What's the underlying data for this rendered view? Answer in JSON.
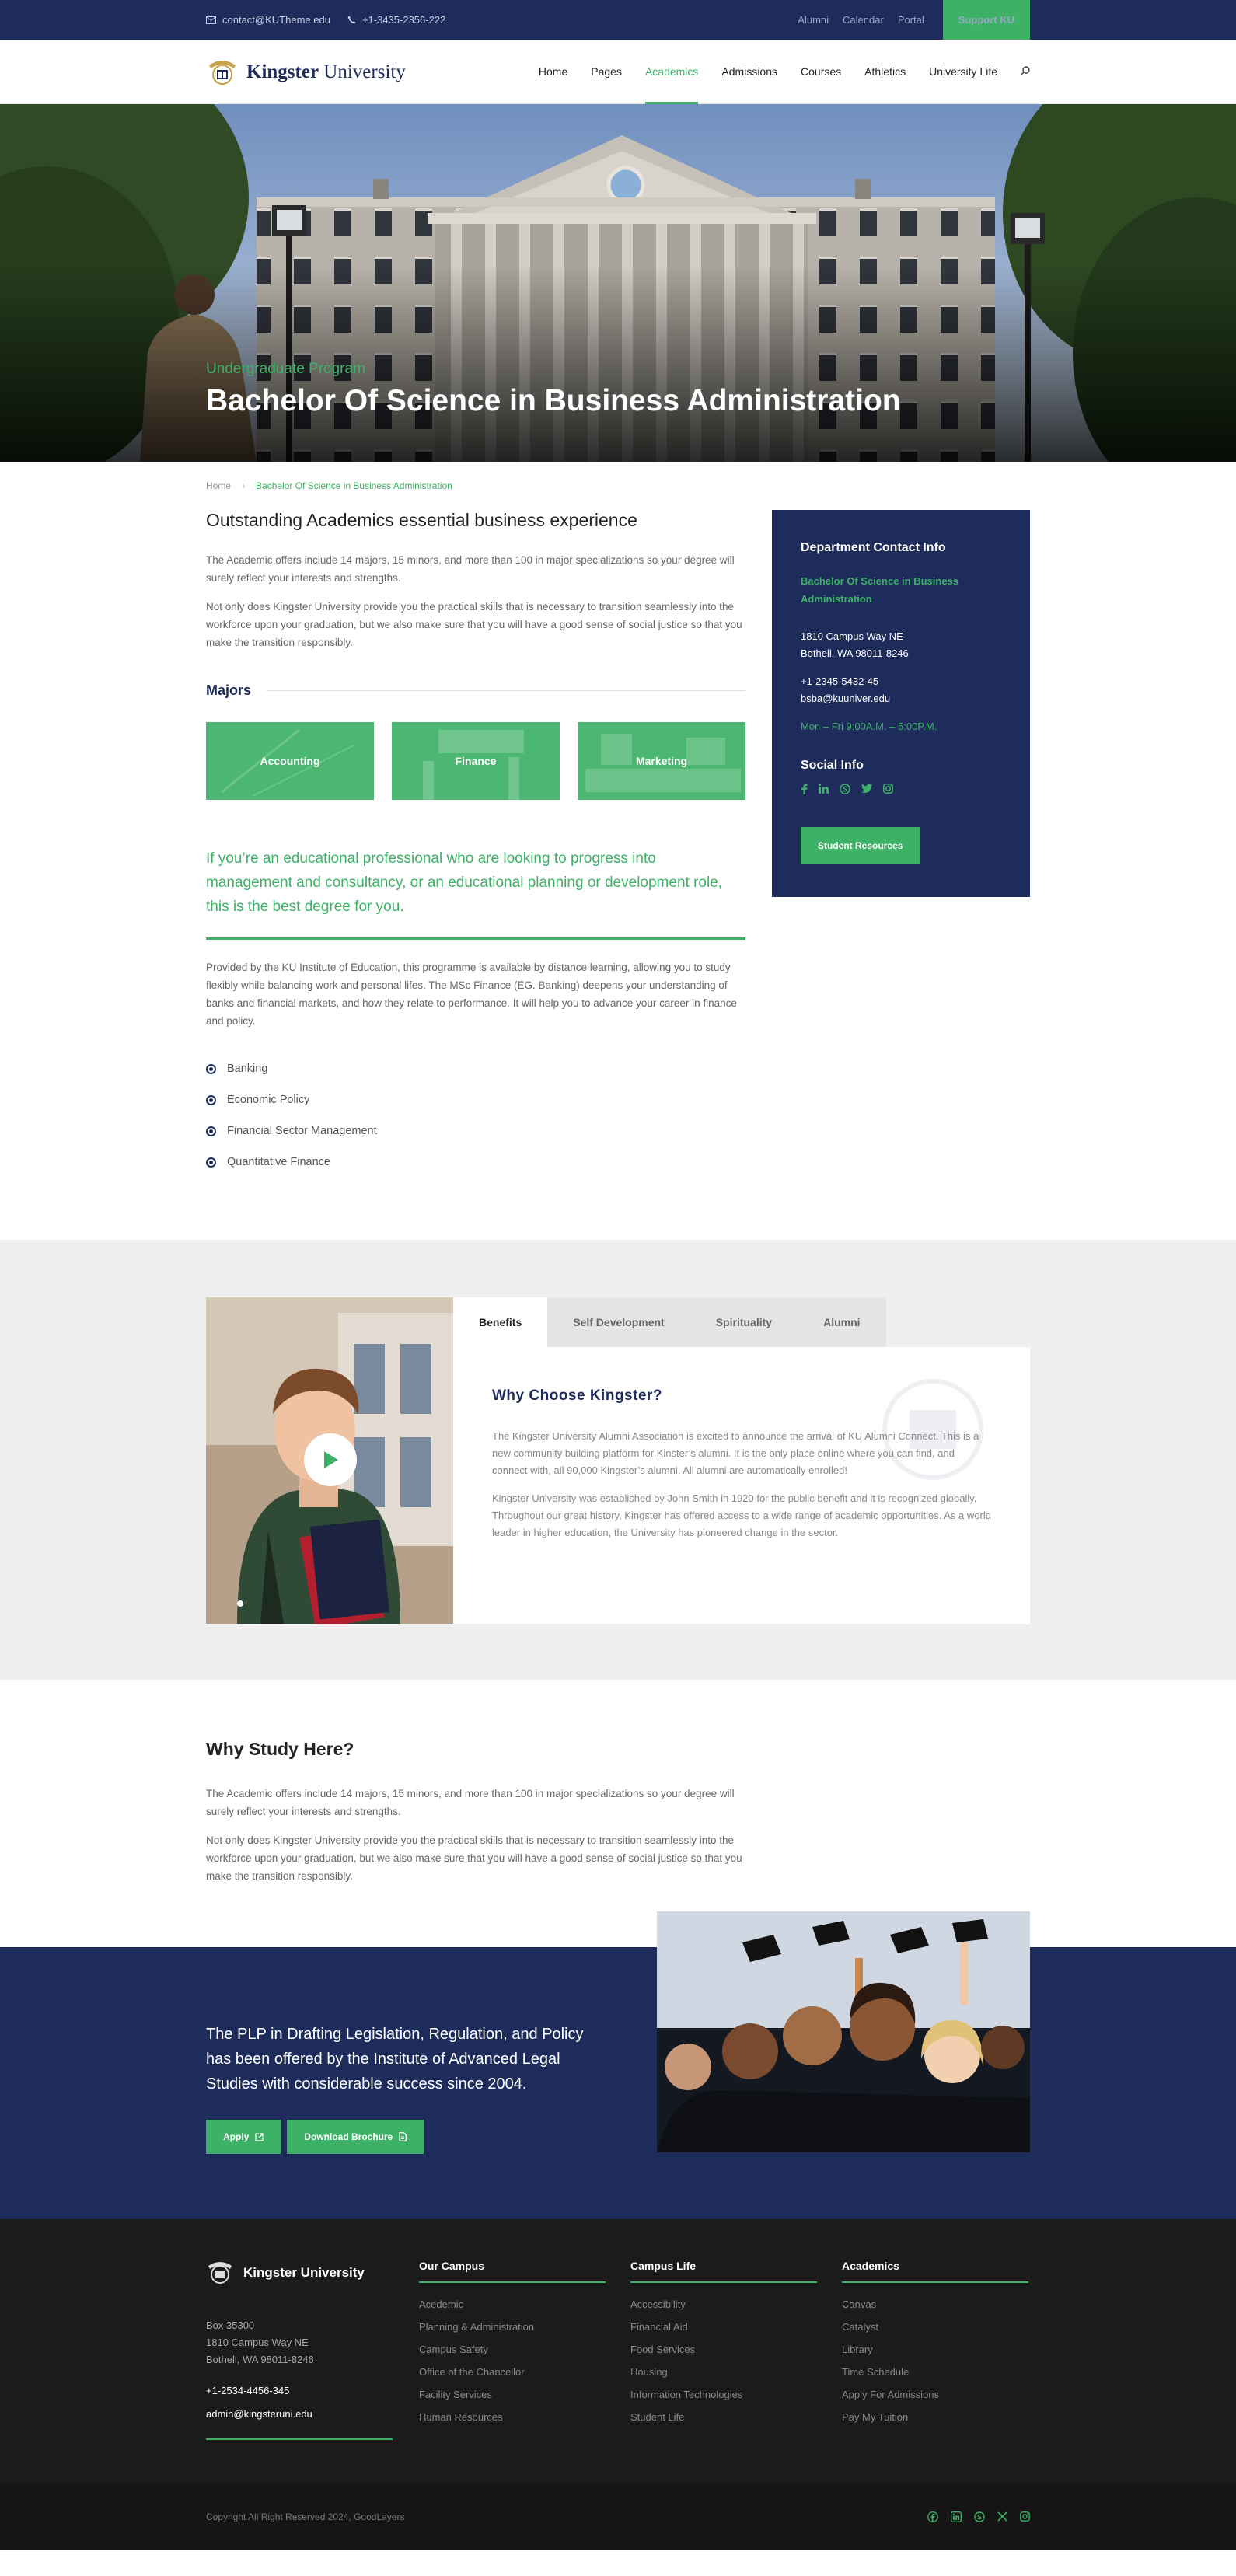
{
  "topbar": {
    "email": "contact@KUTheme.edu",
    "phone": "+1-3435-2356-222",
    "links": [
      "Alumni",
      "Calendar",
      "Portal"
    ],
    "support": "Support KU"
  },
  "header": {
    "logo_bold": "Kingster",
    "logo_rest": " University",
    "nav": [
      "Home",
      "Pages",
      "Academics",
      "Admissions",
      "Courses",
      "Athletics",
      "University Life"
    ],
    "active_nav": "Academics"
  },
  "hero": {
    "subtitle": "Undergraduate Program",
    "title": "Bachelor Of Science in Business Administration"
  },
  "breadcrumb": {
    "home": "Home",
    "sep": "›",
    "current": "Bachelor Of Science in Business Administration"
  },
  "main": {
    "heading": "Outstanding Academics essential business experience",
    "p1": "The Academic offers include 14 majors, 15 minors, and more than 100 in major specializations so your degree will surely reflect your interests and strengths.",
    "p2": "Not only does Kingster University provide you the practical skills that is necessary to transition seamlessly into the workforce upon your graduation, but we also make sure that you will have a good sense of social justice so that you make the transition responsibly.",
    "majors_title": "Majors",
    "majors": [
      "Accounting",
      "Finance",
      "Marketing"
    ],
    "quote": "If you’re an educational professional who are looking to progress into management and consultancy, or an educational planning or development role, this is the best degree for you.",
    "p3": "Provided by the KU Institute of Education, this programme is available by distance learning, allowing you to study flexibly while balancing work and personal lifes. The MSc Finance (EG. Banking) deepens your understanding of banks and financial markets, and how they relate to performance. It will help you to advance your career in finance and policy.",
    "checklist": [
      "Banking",
      "Economic Policy",
      "Financial Sector Management",
      "Quantitative Finance"
    ]
  },
  "sidebar": {
    "title": "Department Contact Info",
    "dept": "Bachelor Of Science in Business Administration",
    "addr1": "1810 Campus Way NE",
    "addr2": "Bothell, WA 98011-8246",
    "phone": "+1-2345-5432-45",
    "email": "bsba@kuuniver.edu",
    "hours": "Mon – Fri 9:00A.M. – 5:00P.M.",
    "social_title": "Social Info",
    "social_icons": [
      "facebook-icon",
      "linkedin-icon",
      "skype-icon",
      "twitter-icon",
      "instagram-icon"
    ],
    "button": "Student Resources"
  },
  "tabs": {
    "items": [
      "Benefits",
      "Self Development",
      "Spirituality",
      "Alumni"
    ],
    "active": "Benefits",
    "heading": "Why Choose Kingster?",
    "p1": "The Kingster University Alumni Association is excited to announce the arrival of KU Alumni Connect. This is a new community building platform for Kinster’s alumni. It is the only place online where you can find, and connect with, all 90,000 Kingster’s alumni. All alumni are automatically enrolled!",
    "p2": "Kingster University was established by John Smith in 1920 for the public benefit and it is recognized globally. Throughout our great history, Kingster has offered access to a wide range of academic opportunities. As a world leader in higher education, the University has pioneered change in the sector."
  },
  "why": {
    "heading": "Why Study Here?",
    "p1": "The Academic offers include 14 majors, 15 minors, and more than 100 in major specializations so your degree will surely reflect your interests and strengths.",
    "p2": "Not only does Kingster University provide you the practical skills that is necessary to transition seamlessly into the workforce upon your graduation, but we also make sure that you will have a good sense of social justice so that you make the transition responsibly."
  },
  "cta": {
    "text": "The PLP in Drafting Legislation, Regulation, and Policy has been offered by the Institute of Advanced Legal Studies with considerable success since 2004.",
    "apply": "Apply",
    "download": "Download Brochure"
  },
  "footer": {
    "logo": "Kingster University",
    "addr0": "Box 35300",
    "addr1": "1810 Campus Way NE",
    "addr2": "Bothell, WA 98011-8246",
    "phone": "+1-2534-4456-345",
    "email": "admin@kingsteruni.edu",
    "cols": [
      {
        "title": "Our Campus",
        "items": [
          "Acedemic",
          "Planning & Administration",
          "Campus Safety",
          "Office of the Chancellor",
          "Facility Services",
          "Human Resources"
        ]
      },
      {
        "title": "Campus Life",
        "items": [
          "Accessibility",
          "Financial Aid",
          "Food Services",
          "Housing",
          "Information Technologies",
          "Student Life"
        ]
      },
      {
        "title": "Academics",
        "items": [
          "Canvas",
          "Catalyst",
          "Library",
          "Time Schedule",
          "Apply For Admissions",
          "Pay My Tuition"
        ]
      }
    ],
    "copyright": "Copyright All Right Reserved 2024, GoodLayers"
  },
  "colors": {
    "navy": "#1e2c5c",
    "green": "#3db166",
    "footer": "#1b1b1b"
  }
}
